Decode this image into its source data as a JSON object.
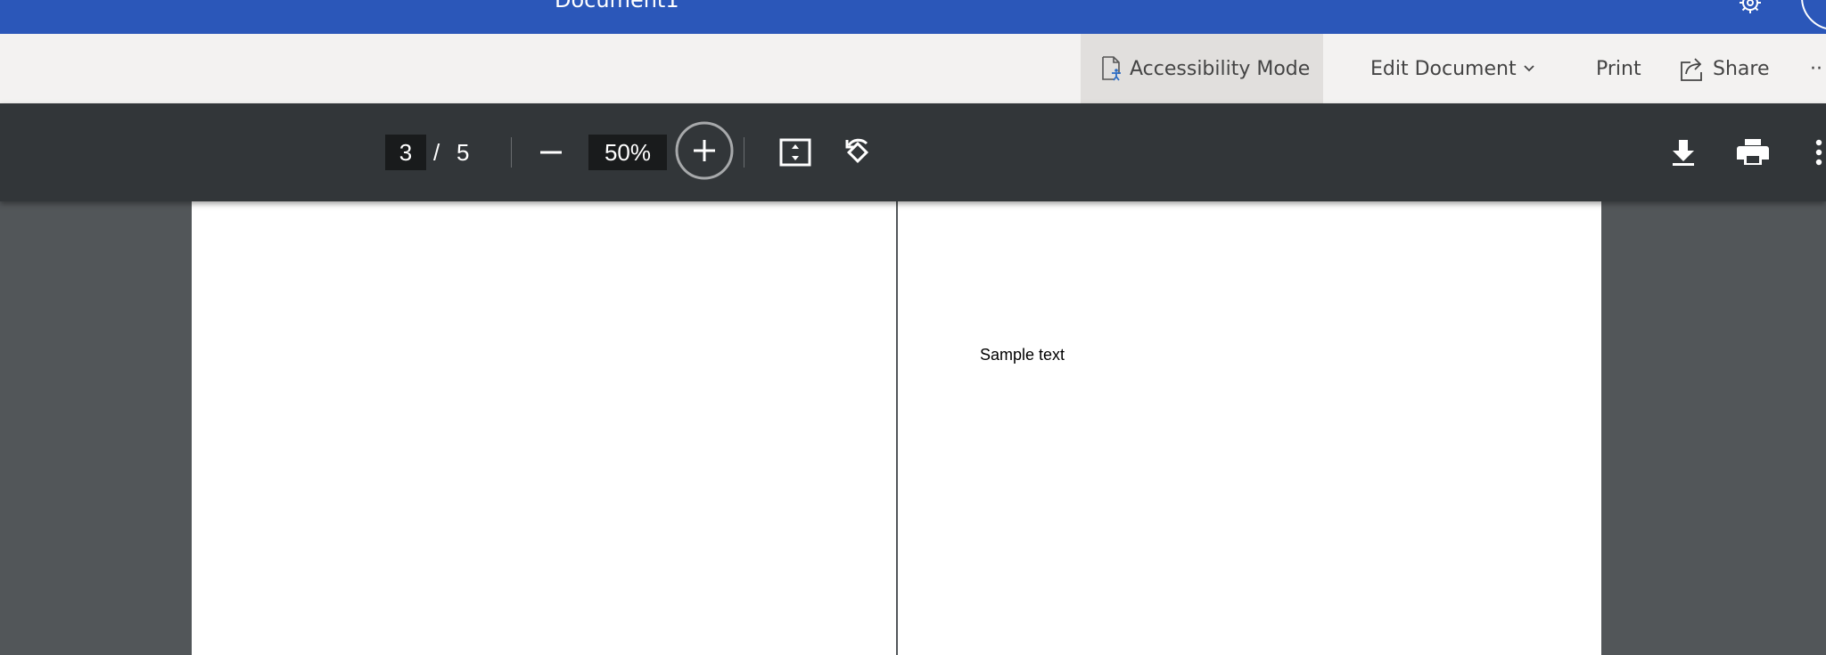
{
  "titlebar": {
    "document_title": "Document1",
    "bg_color": "#2b57b9"
  },
  "ribbon": {
    "accessibility_label": "Accessibility Mode",
    "edit_label": "Edit Document",
    "print_label": "Print",
    "share_label": "Share",
    "more_label": "··"
  },
  "pdf_toolbar": {
    "current_page": "3",
    "page_separator": "/",
    "total_pages": "5",
    "zoom": "50%"
  },
  "document": {
    "sample_text": "Sample text"
  },
  "icons": {
    "accessibility": "accessibility-document-icon",
    "chevron": "chevron-down-icon",
    "share": "share-icon",
    "zoom_out": "minus-icon",
    "zoom_in": "plus-icon",
    "fit": "fit-to-page-icon",
    "rotate": "rotate-icon",
    "download": "download-icon",
    "print": "printer-icon",
    "more": "more-vertical-icon",
    "settings": "gear-icon"
  }
}
